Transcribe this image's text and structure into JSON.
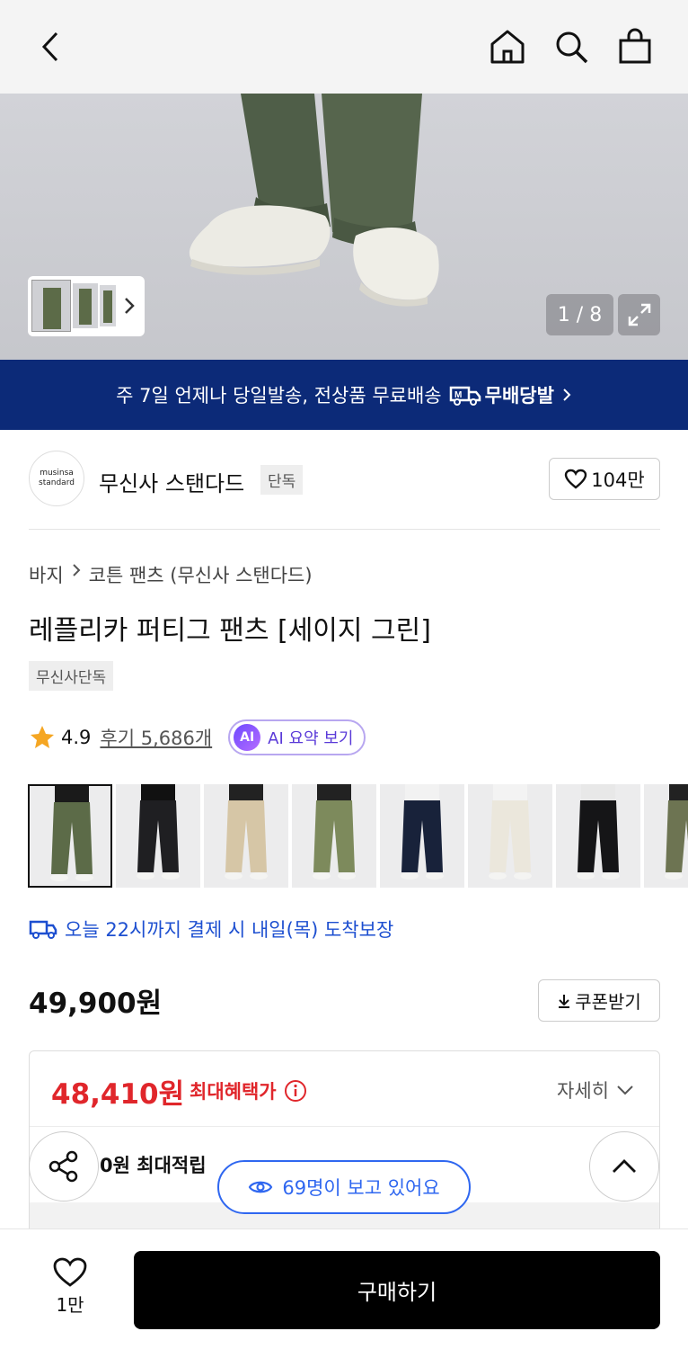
{
  "gallery": {
    "counter": "1 / 8"
  },
  "shipping_banner": {
    "text": "주 7일 언제나 당일발송, 전상품 무료배송",
    "badge": "무배당발"
  },
  "brand": {
    "logo_line1": "musinsa",
    "logo_line2": "standard",
    "name": "무신사 스탠다드",
    "tag": "단독",
    "likes": "104만"
  },
  "breadcrumb": {
    "category": "바지",
    "subcategory": "코튼 팬츠 (무신사 스탠다드)"
  },
  "product": {
    "title": "레플리카 퍼티그 팬츠 [세이지 그린]",
    "exclusive_tag": "무신사단독",
    "rating": "4.9",
    "review_label": "후기 5,686개",
    "ai_badge": "AI",
    "ai_summary_label": "AI 요약 보기"
  },
  "swatches": [
    {
      "name": "sage-green",
      "pants": "#5c6b48",
      "top": "#1a1a1a"
    },
    {
      "name": "black",
      "pants": "#1f1f22",
      "top": "#111111"
    },
    {
      "name": "beige",
      "pants": "#d6c6a6",
      "top": "#222222"
    },
    {
      "name": "olive",
      "pants": "#7d8a5c",
      "top": "#222222"
    },
    {
      "name": "navy",
      "pants": "#18223a",
      "top": "#f2f2f2"
    },
    {
      "name": "ecru",
      "pants": "#ebe7dc",
      "top": "#f3f3f3"
    },
    {
      "name": "charcoal",
      "pants": "#151517",
      "top": "#e8e8e8"
    },
    {
      "name": "khaki",
      "pants": "#6d7452",
      "top": "#222222"
    }
  ],
  "delivery": {
    "text": "오늘 22시까지 결제 시 내일(목) 도착보장"
  },
  "price": {
    "original": "49,900원",
    "coupon_label": "쿠폰받기"
  },
  "benefit": {
    "max_price": "48,410원",
    "max_label": "최대혜택가",
    "detail_label": "자세히",
    "points": "0원 최대적립"
  },
  "viewers": {
    "text": "69명이 보고 있어요"
  },
  "bottom": {
    "wish_count": "1만",
    "buy_label": "구매하기"
  },
  "colors": {
    "banner": "#0c2a78",
    "accent_red": "#e0262b",
    "accent_blue": "#2f67f0",
    "ai_purple": "#5a3ad8"
  }
}
